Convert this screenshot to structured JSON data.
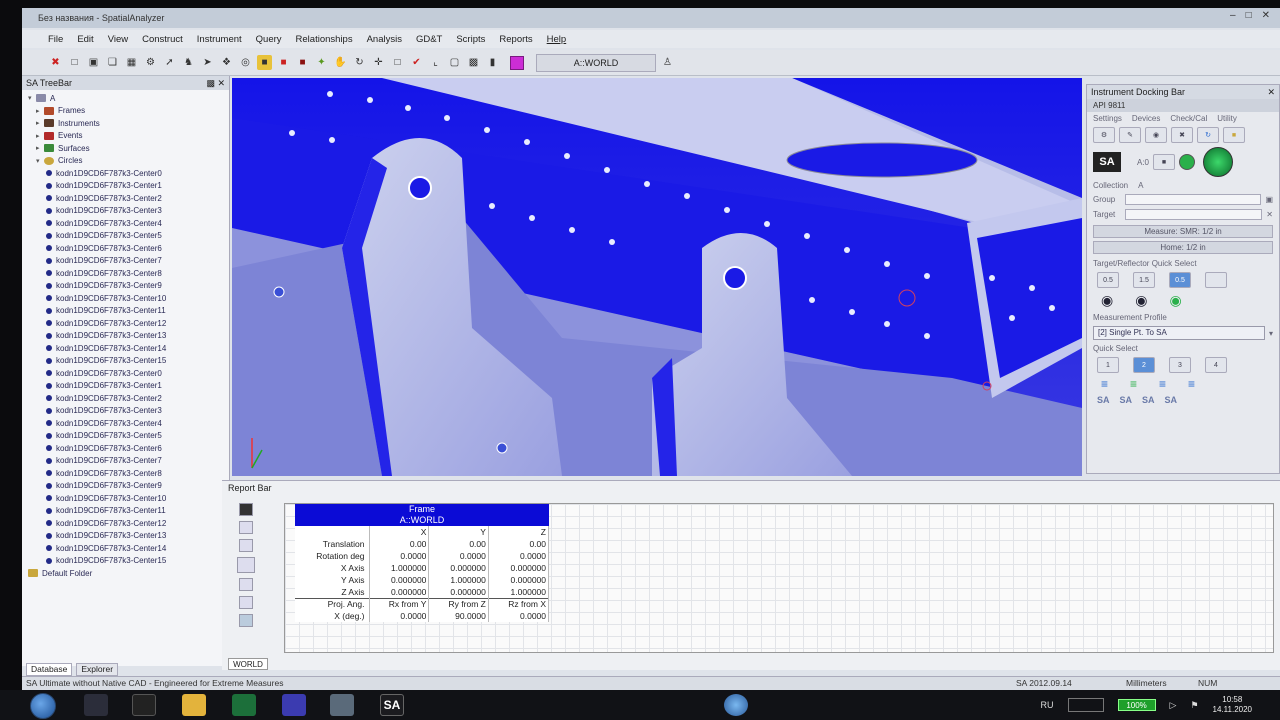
{
  "window": {
    "title": "Без названия - SpatialAnalyzer"
  },
  "menu": [
    "File",
    "Edit",
    "View",
    "Construct",
    "Instrument",
    "Query",
    "Relationships",
    "Analysis",
    "GD&T",
    "Scripts",
    "Reports",
    "Help"
  ],
  "toolbar": {
    "frame_selector": "A::WORLD"
  },
  "treebar": {
    "title": "SA TreeBar",
    "root": "A",
    "groups": [
      "Frames",
      "Instruments",
      "Events",
      "Surfaces",
      "Circles"
    ],
    "circles": [
      "kodn1D9CD6F787k3-Center0",
      "kodn1D9CD6F787k3-Center1",
      "kodn1D9CD6F787k3-Center2",
      "kodn1D9CD6F787k3-Center3",
      "kodn1D9CD6F787k3-Center4",
      "kodn1D9CD6F787k3-Center5",
      "kodn1D9CD6F787k3-Center6",
      "kodn1D9CD6F787k3-Center7",
      "kodn1D9CD6F787k3-Center8",
      "kodn1D9CD6F787k3-Center9",
      "kodn1D9CD6F787k3-Center10",
      "kodn1D9CD6F787k3-Center11",
      "kodn1D9CD6F787k3-Center12",
      "kodn1D9CD6F787k3-Center13",
      "kodn1D9CD6F787k3-Center14",
      "kodn1D9CD6F787k3-Center15",
      "kodn1D9CD6F787k3-Center0",
      "kodn1D9CD6F787k3-Center1",
      "kodn1D9CD6F787k3-Center2",
      "kodn1D9CD6F787k3-Center3",
      "kodn1D9CD6F787k3-Center4",
      "kodn1D9CD6F787k3-Center5",
      "kodn1D9CD6F787k3-Center6",
      "kodn1D9CD6F787k3-Center7",
      "kodn1D9CD6F787k3-Center8",
      "kodn1D9CD6F787k3-Center9",
      "kodn1D9CD6F787k3-Center10",
      "kodn1D9CD6F787k3-Center11",
      "kodn1D9CD6F787k3-Center12",
      "kodn1D9CD6F787k3-Center13",
      "kodn1D9CD6F787k3-Center14",
      "kodn1D9CD6F787k3-Center15"
    ],
    "folder": "Default Folder",
    "tabs": [
      "Database",
      "Explorer"
    ]
  },
  "dock": {
    "title": "Instrument Docking Bar",
    "instrument": "API 9811",
    "tabs": [
      "Settings",
      "Devices",
      "Check/Cal",
      "Utility"
    ],
    "collection_label": "Collection",
    "collection_value": "A",
    "group_label": "Group",
    "target_label": "Target",
    "az_label": "A:0",
    "measure_button": "Measure: SMR: 1/2 in",
    "home_button": "Home: 1/2 in",
    "quick_select_title": "Target/Reflector Quick Select",
    "reflector_sizes": [
      "0.5",
      "1.5",
      "0.5"
    ],
    "measurement_profile_label": "Measurement Profile",
    "measurement_profile_value": "[2] Single Pt. To SA",
    "quick_select_label": "Quick Select",
    "quick_numbers": [
      "1",
      "2",
      "3",
      "4"
    ],
    "sa_logo": "SA"
  },
  "report": {
    "title": "Report Bar",
    "frame_label": "Frame",
    "frame_name": "A::WORLD",
    "columns": [
      "X",
      "Y",
      "Z"
    ],
    "rows": [
      {
        "label": "Translation",
        "x": "0.00",
        "y": "0.00",
        "z": "0.00"
      },
      {
        "label": "Rotation deg",
        "x": "0.0000",
        "y": "0.0000",
        "z": "0.0000"
      },
      {
        "label": "X Axis",
        "x": "1.000000",
        "y": "0.000000",
        "z": "0.000000"
      },
      {
        "label": "Y Axis",
        "x": "0.000000",
        "y": "1.000000",
        "z": "0.000000"
      },
      {
        "label": "Z Axis",
        "x": "0.000000",
        "y": "0.000000",
        "z": "1.000000"
      }
    ],
    "proj_label": "Proj. Ang.",
    "proj_unit_label": "X (deg.)",
    "proj_headers": [
      "Rx from Y",
      "Ry from Z",
      "Rz from X"
    ],
    "proj_values": [
      "0.0000",
      "90.0000",
      "0.0000"
    ],
    "world_tab": "WORLD"
  },
  "status": {
    "left": "SA Ultimate without Native CAD - Engineered for Extreme Measures",
    "version": "SA 2012.09.14",
    "units": "Millimeters",
    "num": "NUM"
  },
  "taskbar": {
    "lang": "RU",
    "battery": "100%",
    "time": "10:58",
    "date": "14.11.2020",
    "sa_label": "SA"
  }
}
